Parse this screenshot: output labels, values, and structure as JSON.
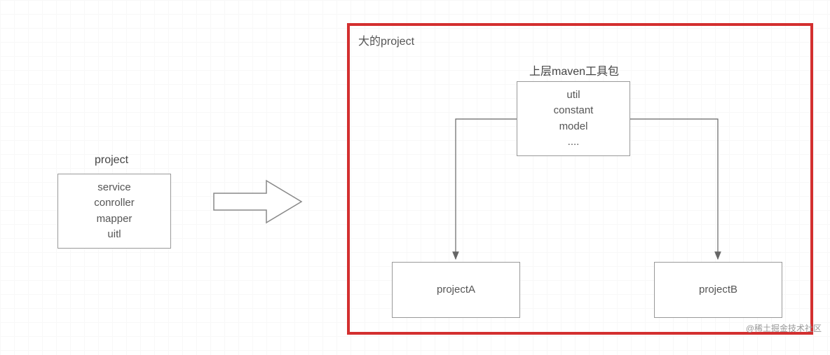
{
  "left": {
    "label": "project",
    "box_lines": [
      "service",
      "conroller",
      "mapper",
      "uitl"
    ]
  },
  "big_project": {
    "label": "大的project",
    "top_label": "上层maven工具包",
    "util_box_lines": [
      "util",
      "constant",
      "model",
      "...."
    ],
    "projectA": "projectA",
    "projectB": "projectB"
  },
  "watermarks": {
    "main": "@稀土掘金技术社区",
    "sub": ""
  }
}
